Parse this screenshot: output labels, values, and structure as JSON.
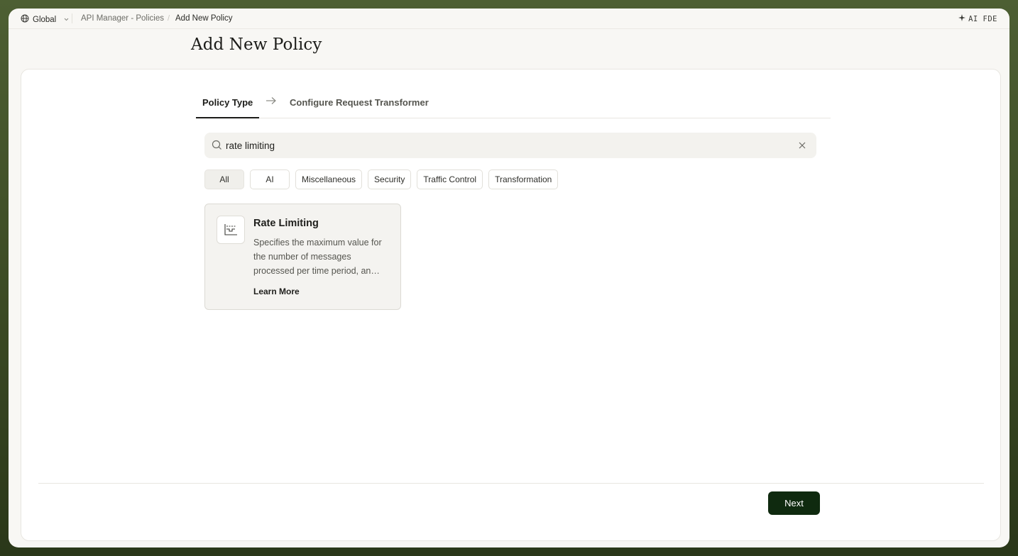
{
  "topbar": {
    "workspace": "Global",
    "breadcrumbs": [
      "API Manager - Policies",
      "Add New Policy"
    ],
    "assistant": "AI FDE",
    "icons": {
      "workspace": "globe-icon",
      "workspace_menu": "chevron-down-icon",
      "assistant": "sparkle-icon"
    }
  },
  "page": {
    "title": "Add New Policy"
  },
  "steps": [
    {
      "label": "Policy Type",
      "active": true
    },
    {
      "label": "Configure Request Transformer",
      "active": false
    }
  ],
  "search": {
    "value": "rate limiting",
    "placeholder": ""
  },
  "filters": [
    {
      "label": "All",
      "active": true
    },
    {
      "label": "AI",
      "active": false
    },
    {
      "label": "Miscellaneous",
      "active": false
    },
    {
      "label": "Security",
      "active": false
    },
    {
      "label": "Traffic Control",
      "active": false
    },
    {
      "label": "Transformation",
      "active": false
    }
  ],
  "results": [
    {
      "title": "Rate Limiting",
      "description": "Specifies the maximum value for the number of messages processed per time period, an…",
      "link": "Learn More",
      "icon": "rate-limit-chart-icon"
    }
  ],
  "footer": {
    "next_label": "Next"
  },
  "colors": {
    "primary": "#0f2a0f",
    "background": "#3b4a24"
  }
}
